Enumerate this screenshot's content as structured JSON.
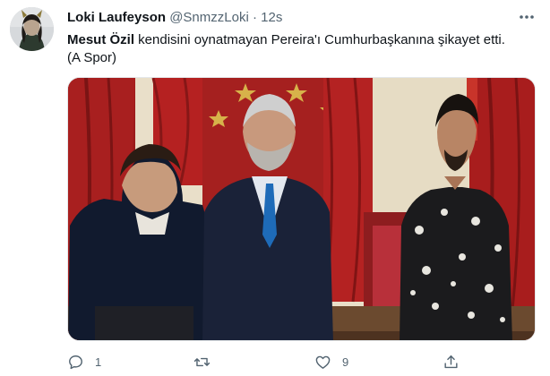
{
  "tweet": {
    "author_name": "Loki Laufeyson",
    "handle": "@SnmzzLoki",
    "separator": "·",
    "time": "12s",
    "text_mention": "Mesut Özil",
    "text_rest": " kendisini oynatmayan Pereira'ı Cumhurbaşkanına şikayet etti.",
    "text_line2": "(A Spor)"
  },
  "actions": {
    "reply_count": "1",
    "retweet_count": "",
    "like_count": "9"
  },
  "icons": {
    "avatar": "profile-avatar",
    "more": "more-options-icon",
    "reply": "reply-icon",
    "retweet": "retweet-icon",
    "like": "heart-icon",
    "share": "share-icon"
  },
  "colors": {
    "text_primary": "#0f1419",
    "text_secondary": "#536471",
    "border": "#e4e8eb"
  }
}
